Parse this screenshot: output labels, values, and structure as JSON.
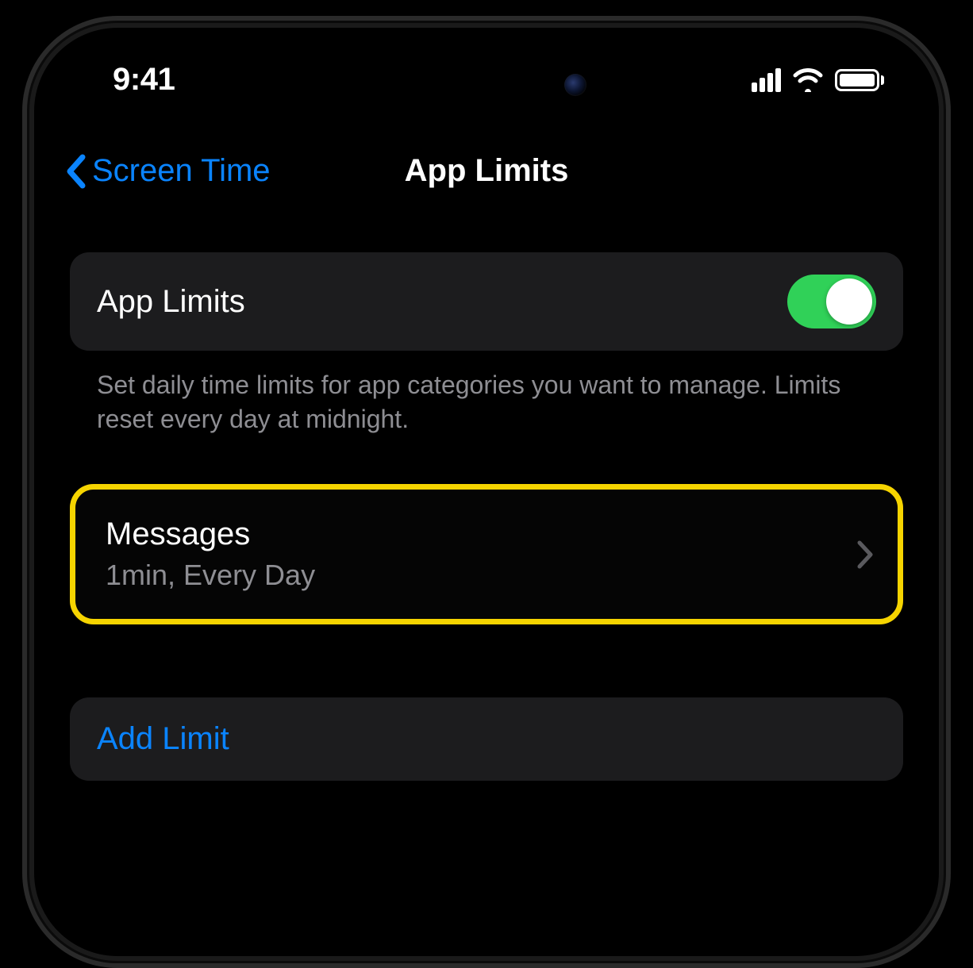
{
  "statusBar": {
    "time": "9:41"
  },
  "nav": {
    "back_label": "Screen Time",
    "title": "App Limits"
  },
  "toggleSection": {
    "label": "App Limits",
    "footer": "Set daily time limits for app categories you want to manage. Limits reset every day at midnight.",
    "enabled": true
  },
  "limits": [
    {
      "title": "Messages",
      "subtitle": "1min, Every Day"
    }
  ],
  "addLimit": {
    "label": "Add Limit"
  },
  "colors": {
    "accent": "#0a84ff",
    "toggleOn": "#30d158",
    "highlight": "#f6d400"
  }
}
